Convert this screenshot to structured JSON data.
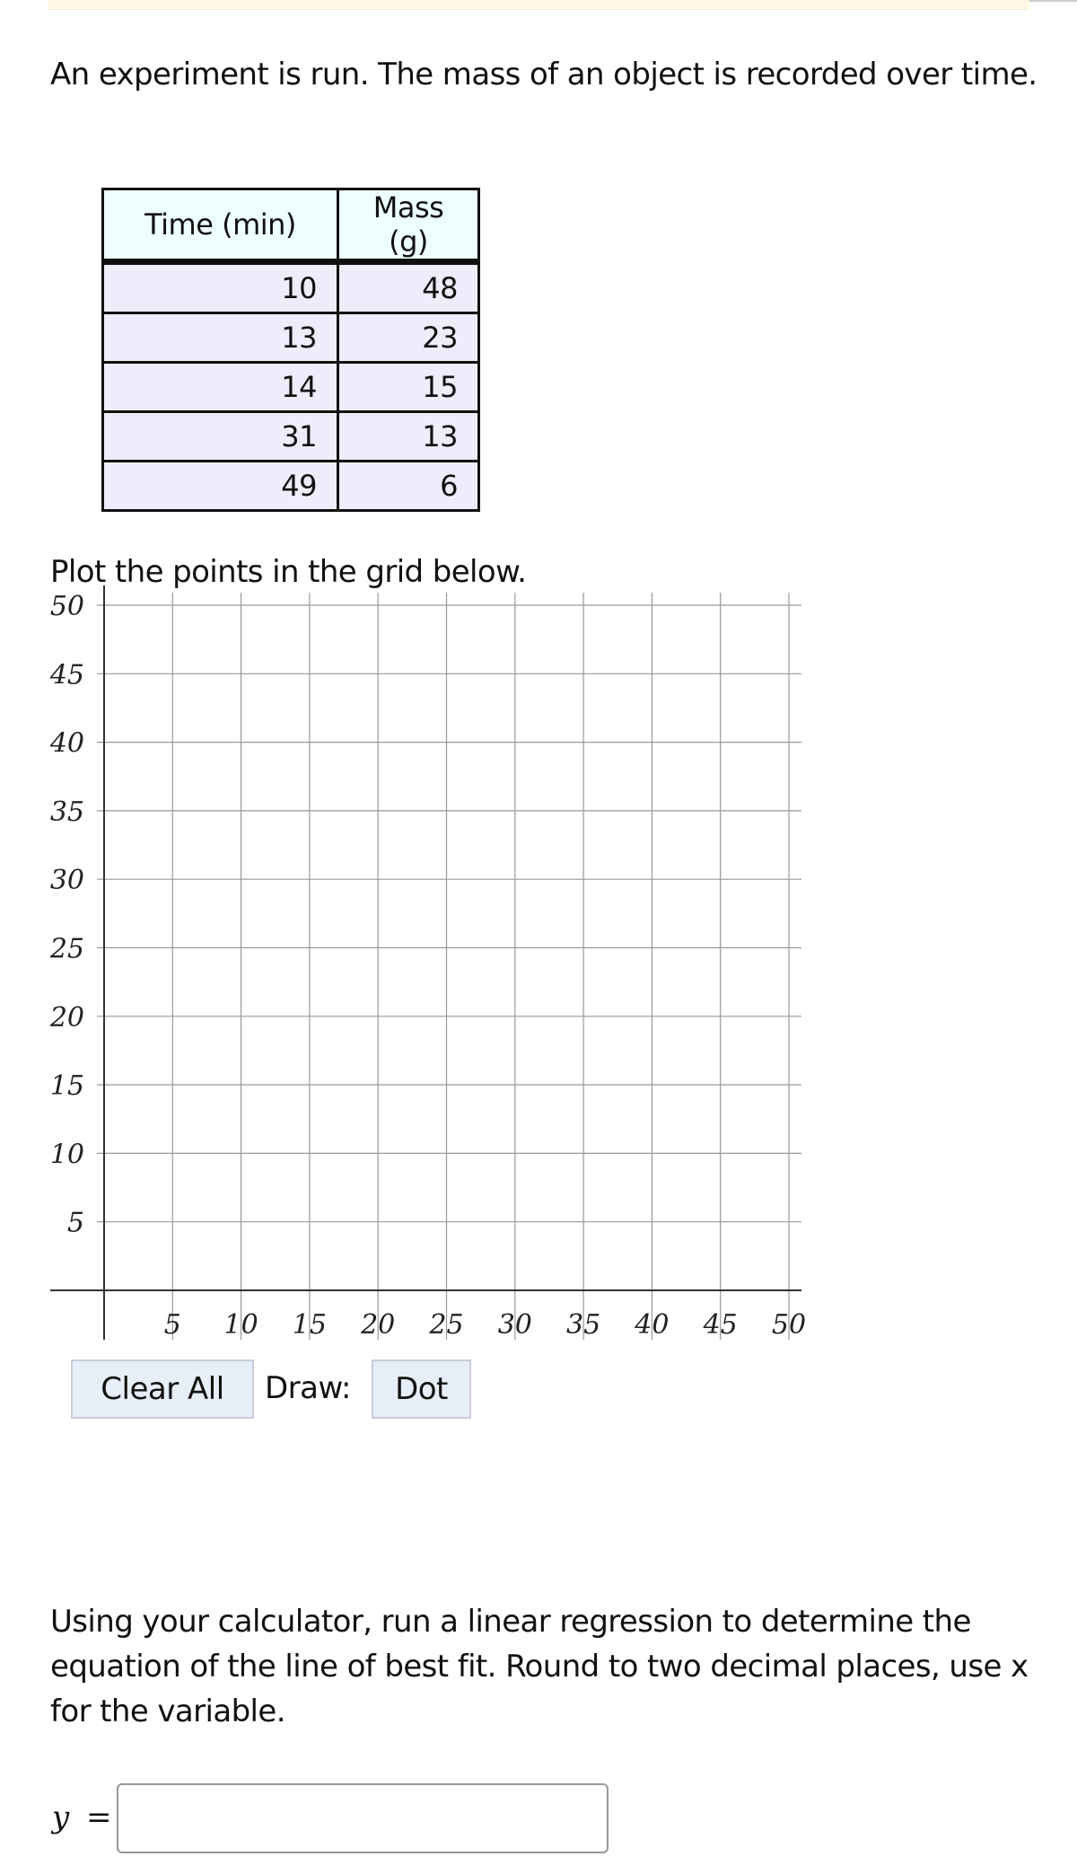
{
  "intro": "An experiment is run. The mass of an object is recorded over time.",
  "table": {
    "headers": [
      "Time (min)",
      "Mass (g)"
    ],
    "rows": [
      [
        "10",
        "48"
      ],
      [
        "13",
        "23"
      ],
      [
        "14",
        "15"
      ],
      [
        "31",
        "13"
      ],
      [
        "49",
        "6"
      ]
    ]
  },
  "plot_instruction": "Plot the points in the grid below.",
  "grid": {
    "x_ticks": [
      "5",
      "10",
      "15",
      "20",
      "25",
      "30",
      "35",
      "40",
      "45",
      "50"
    ],
    "y_ticks": [
      "50",
      "45",
      "40",
      "35",
      "30",
      "25",
      "20",
      "15",
      "10",
      "5"
    ],
    "xlim": [
      0,
      50
    ],
    "ylim": [
      0,
      50
    ],
    "grid": true,
    "points": []
  },
  "controls": {
    "clear_all": "Clear All",
    "draw_label": "Draw:",
    "draw_mode": "Dot"
  },
  "regression_prompt": "Using your calculator, run a linear regression to determine the equation of the line of best fit. Round to two decimal places, use x for the variable.",
  "answer": {
    "y_label": "y",
    "equals": "=",
    "value": ""
  }
}
